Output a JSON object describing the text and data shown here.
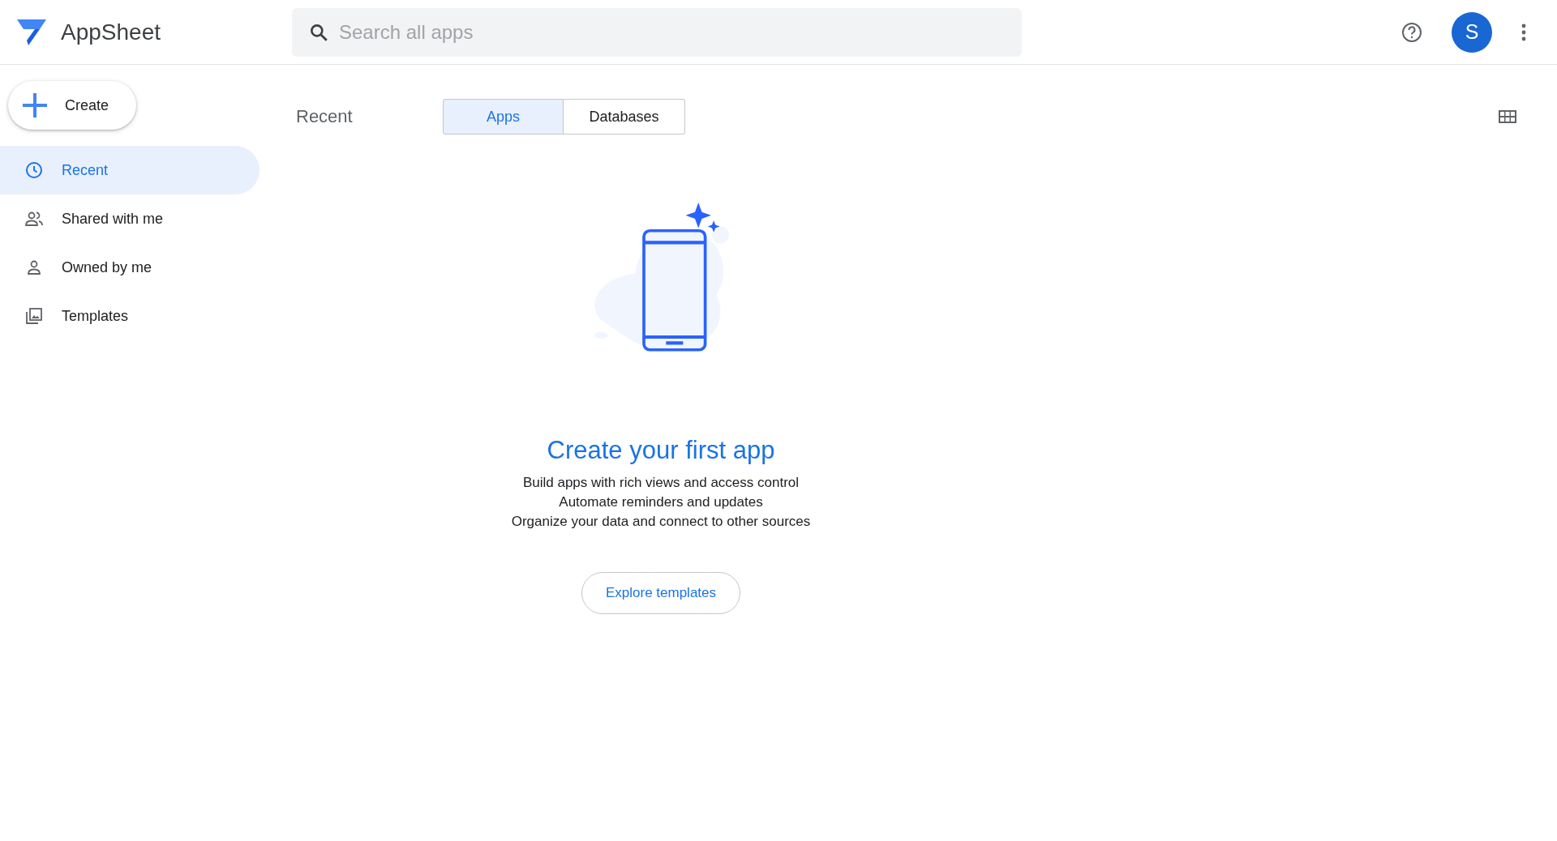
{
  "header": {
    "app_name": "AppSheet",
    "search": {
      "placeholder": "Search all apps"
    },
    "avatar": "S"
  },
  "sidebar": {
    "create_button": "Create",
    "items": [
      {
        "label": "Recent",
        "kind": "clock",
        "selected": true
      },
      {
        "label": "Shared with me",
        "kind": "people",
        "selected": false
      },
      {
        "label": "Owned by me",
        "kind": "person",
        "selected": false
      },
      {
        "label": "Templates",
        "kind": "gallery",
        "selected": false
      }
    ]
  },
  "main": {
    "title": "Recent",
    "tabs": [
      {
        "label": "Apps",
        "selected": true
      },
      {
        "label": "Databases",
        "selected": false
      }
    ],
    "empty_state": {
      "heading": "Create your first app",
      "lines": [
        "Build apps with rich views and access control",
        "Automate reminders and updates",
        "Organize your data and connect to other sources"
      ],
      "button": "Explore templates"
    }
  }
}
